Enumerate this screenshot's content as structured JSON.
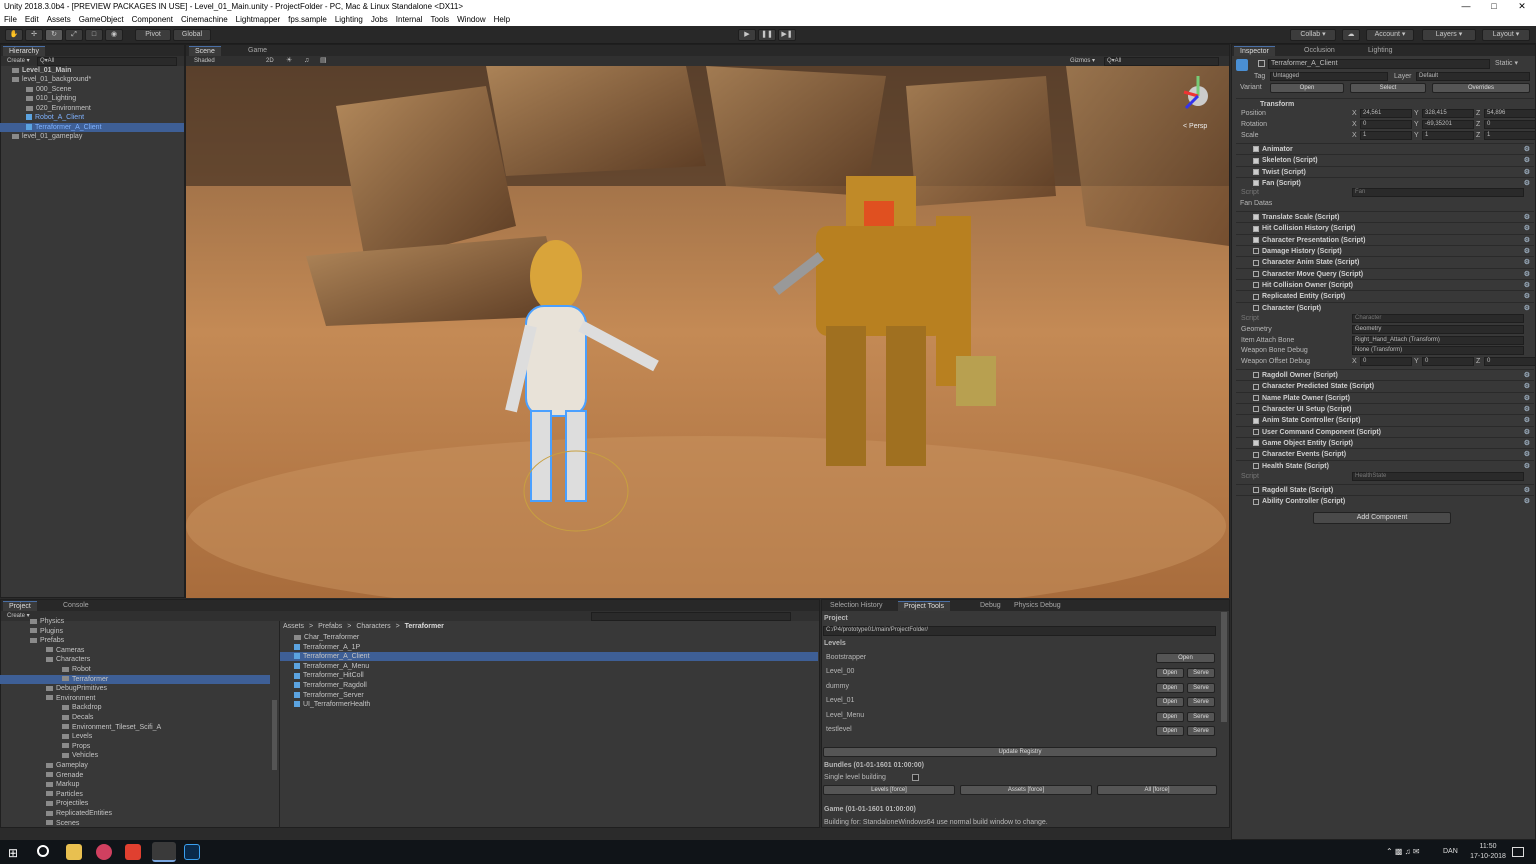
{
  "window": {
    "title": "Unity 2018.3.0b4 - [PREVIEW PACKAGES IN USE] - Level_01_Main.unity - ProjectFolder - PC, Mac & Linux Standalone <DX11>"
  },
  "menu": [
    "File",
    "Edit",
    "Assets",
    "GameObject",
    "Component",
    "Cinemachine",
    "Lightmapper",
    "fps.sample",
    "Lighting",
    "Jobs",
    "Internal",
    "Tools",
    "Window",
    "Help"
  ],
  "toolbar": {
    "pivot": "Pivot",
    "global": "Global",
    "collab": "Collab ▾",
    "account": "Account ▾",
    "layers": "Layers ▾",
    "layout": "Layout ▾"
  },
  "hierarchy": {
    "tab": "Hierarchy",
    "create": "Create ▾",
    "search": "Q▾All",
    "items": [
      "Level_01_Main",
      "level_01_background*",
      "000_Scene",
      "010_Lighting",
      "020_Environment",
      "Robot_A_Client",
      "Terraformer_A_Client",
      "level_01_gameplay"
    ]
  },
  "scene": {
    "tab_scene": "Scene",
    "tab_game": "Game",
    "shaded": "Shaded",
    "mode_2d": "2D",
    "gizmos": "Gizmos ▾",
    "search": "Q▾All",
    "persp": "< Persp"
  },
  "inspector": {
    "tab": "Inspector",
    "tab_occlusion": "Occlusion",
    "tab_lighting": "Lighting",
    "object_name": "Terraformer_A_Client",
    "static": "Static ▾",
    "tag_label": "Tag",
    "tag_value": "Untagged",
    "layer_label": "Layer",
    "layer_value": "Default",
    "variant_label": "Variant",
    "open": "Open",
    "select": "Select",
    "overrides": "Overrides",
    "transform": "Transform",
    "position_label": "Position",
    "position": {
      "x": "24,561",
      "y": "328,415",
      "z": "54,896"
    },
    "rotation_label": "Rotation",
    "rotation": {
      "x": "0",
      "y": "-69,35201",
      "z": "0"
    },
    "scale_label": "Scale",
    "scale": {
      "x": "1",
      "y": "1",
      "z": "1"
    },
    "components_a": [
      "Animator",
      "Skeleton (Script)",
      "Twist (Script)",
      "Fan (Script)"
    ],
    "fan_script": "Fan",
    "fan_datas": "Fan Datas",
    "script_label": "Script",
    "components_b": [
      "Translate Scale (Script)",
      "Hit Collision History (Script)",
      "Character Presentation (Script)",
      "Damage History (Script)",
      "Character Anim State (Script)",
      "Character Move Query (Script)",
      "Hit Collision Owner (Script)",
      "Replicated Entity (Script)",
      "Character (Script)"
    ],
    "character_fields": [
      {
        "label": "Script",
        "value": "Character"
      },
      {
        "label": "Geometry",
        "value": "Geometry"
      },
      {
        "label": "Item Attach Bone",
        "value": "Right_Hand_Attach (Transform)"
      },
      {
        "label": "Weapon Bone Debug",
        "value": "None (Transform)"
      }
    ],
    "weapon_offset_label": "Weapon Offset Debug",
    "weapon_offset": {
      "x": "0",
      "y": "0",
      "z": "0"
    },
    "components_c": [
      "Ragdoll Owner (Script)",
      "Character Predicted State (Script)",
      "Name Plate Owner (Script)",
      "Character UI Setup (Script)",
      "Anim State Controller (Script)",
      "User Command Component (Script)",
      "Game Object Entity (Script)",
      "Character Events (Script)",
      "Health State (Script)"
    ],
    "health_script": "HealthState",
    "components_d": [
      "Ragdoll State (Script)",
      "Ability Controller (Script)"
    ],
    "add_component": "Add Component"
  },
  "project": {
    "tab": "Project",
    "tab_console": "Console",
    "create": "Create ▾",
    "tree": [
      "Physics",
      "Plugins",
      "Prefabs",
      "Cameras",
      "Characters",
      "Robot",
      "Terraformer",
      "DebugPrimitives",
      "Environment",
      "Backdrop",
      "Decals",
      "Environment_Tileset_Scifi_A",
      "Levels",
      "Props",
      "Vehicles",
      "Gameplay",
      "Grenade",
      "Markup",
      "Particles",
      "Projectiles",
      "ReplicatedEntities",
      "Scenes"
    ],
    "breadcrumb": [
      "Assets",
      "Prefabs",
      "Characters",
      "Terraformer"
    ],
    "assets": [
      "Char_Terraformer",
      "Terraformer_A_1P",
      "Terraformer_A_Client",
      "Terraformer_A_Menu",
      "Terraformer_HitColl",
      "Terraformer_Ragdoll",
      "Terraformer_Server",
      "UI_TerraformerHealth"
    ]
  },
  "tools": {
    "tabs": [
      "Selection History",
      "Project Tools",
      "Debug",
      "Physics Debug"
    ],
    "project_heading": "Project",
    "project_path": "C:/P4/prototype01/main/ProjectFolder/",
    "levels_heading": "Levels",
    "open": "Open",
    "serve": "Serve",
    "levels": [
      "Bootstrapper",
      "Level_00",
      "dummy",
      "Level_01",
      "Level_Menu",
      "testlevel"
    ],
    "update_registry": "Update Registry",
    "bundles_heading": "Bundles (01-01-1601 01:00:00)",
    "single_level": "Single level building",
    "levels_force": "Levels [force]",
    "assets_force": "Assets [force]",
    "all_force": "All [force]",
    "game_heading": "Game (01-01-1601 01:00:00)",
    "building_for": "Building for: StandaloneWindows64 use normal build window to change."
  },
  "taskbar": {
    "time": "11:50",
    "date": "17-10-2018",
    "lang": "DAN"
  },
  "colors": {
    "selection": "#3e5f96",
    "panel": "#383838",
    "accent": "#4a6fa5"
  }
}
